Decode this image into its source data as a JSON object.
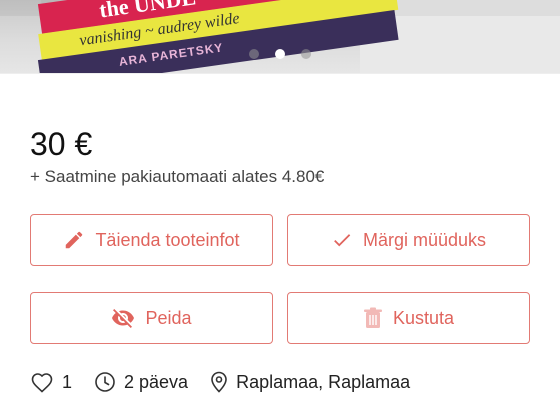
{
  "photo": {
    "book_titles": [
      "the UNDE",
      "vanishing",
      "audrey wilde",
      "ARA PARETSKY"
    ],
    "carousel": {
      "dot_count": 3,
      "active_index": 1
    }
  },
  "listing": {
    "price": "30 €",
    "shipping": "+ Saatmine pakiautomaati alates 4.80€"
  },
  "actions": {
    "edit_label": "Täienda tooteinfot",
    "sold_label": "Märgi müüduks",
    "hide_label": "Peida",
    "delete_label": "Kustuta"
  },
  "meta": {
    "likes": "1",
    "age": "2 päeva",
    "location": "Raplamaa, Raplamaa"
  },
  "colors": {
    "accent": "#e0645d",
    "accent_border": "#e27a74"
  },
  "icons": {
    "edit": "pencil-icon",
    "sold": "checkmark-icon",
    "hide": "eye-off-icon",
    "delete": "trash-icon",
    "likes": "heart-icon",
    "age": "clock-icon",
    "location": "location-pin-icon"
  }
}
